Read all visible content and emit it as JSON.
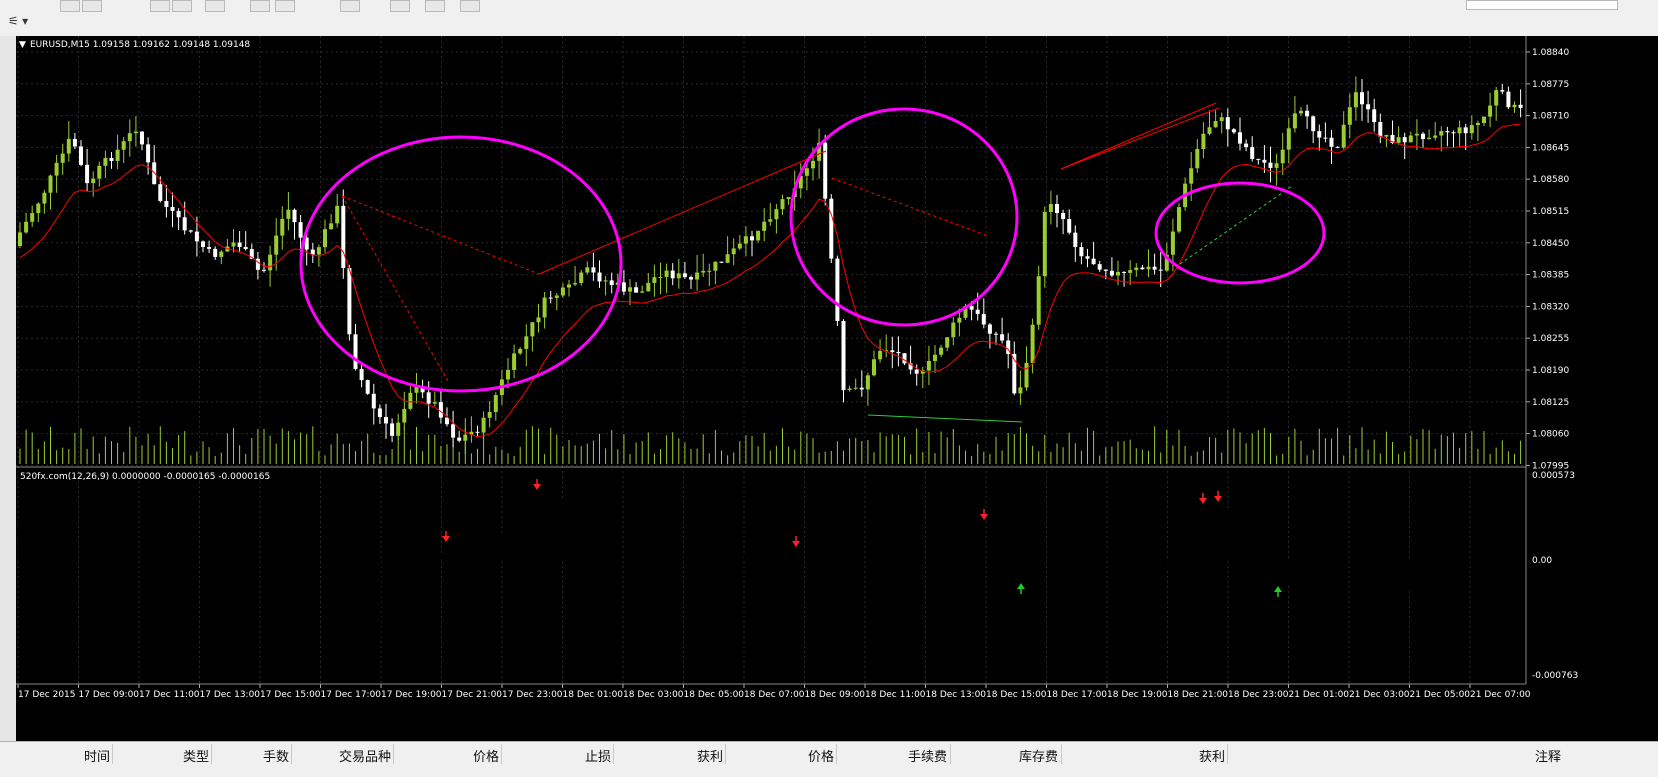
{
  "chart_header": {
    "title": "EURUSD,M15  1.09158 1.09162 1.09148 1.09148"
  },
  "indicator_header": {
    "title": "520fx.com(12,26,9) 0.0000000 -0.0000165 -0.0000165"
  },
  "price_axis": [
    "1.08840",
    "1.08775",
    "1.08710",
    "1.08645",
    "1.08580",
    "1.08515",
    "1.08450",
    "1.08385",
    "1.08320",
    "1.08255",
    "1.08190",
    "1.08125",
    "1.08060",
    "1.07995"
  ],
  "indicator_axis": [
    "0.000573",
    "0.00",
    "-0.000763"
  ],
  "time_axis": [
    "17 Dec 2015",
    "17 Dec 09:00",
    "17 Dec 11:00",
    "17 Dec 13:00",
    "17 Dec 15:00",
    "17 Dec 17:00",
    "17 Dec 19:00",
    "17 Dec 21:00",
    "17 Dec 23:00",
    "18 Dec 01:00",
    "18 Dec 03:00",
    "18 Dec 05:00",
    "18 Dec 07:00",
    "18 Dec 09:00",
    "18 Dec 11:00",
    "18 Dec 13:00",
    "18 Dec 15:00",
    "18 Dec 17:00",
    "18 Dec 19:00",
    "18 Dec 21:00",
    "18 Dec 23:00",
    "21 Dec 01:00",
    "21 Dec 03:00",
    "21 Dec 05:00",
    "21 Dec 07:00"
  ],
  "bottom_columns": [
    "时间",
    "类型",
    "手数",
    "交易品种",
    "价格",
    "止损",
    "获利",
    "价格",
    "手续费",
    "库存费",
    "获利",
    "注释"
  ],
  "colors": {
    "bull": "#9acd32",
    "bear": "#ffffff",
    "ma": "#ff0000",
    "hist_up": "#2ecc40",
    "hist_down": "#b22222",
    "ellipse": "#ff00ff",
    "grid": "#2a2a2a",
    "axis_text": "#ffffff"
  },
  "icons": [
    "chart-tool-icon",
    "dropdown-arrow-icon",
    "collapse-triangle-icon"
  ]
}
